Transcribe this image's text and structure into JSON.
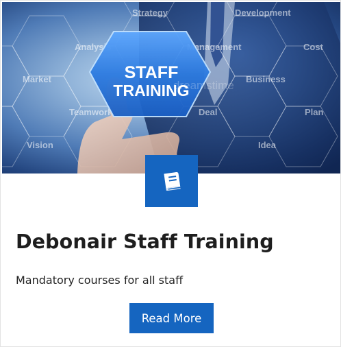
{
  "card": {
    "title": "Debonair Staff Training",
    "description": "Mandatory courses for all staff",
    "button_label": "Read More"
  },
  "hero": {
    "badge_line1": "STAFF",
    "badge_line2": "TRAINING",
    "watermark": "dreamstime",
    "hex_words": [
      "Analysis",
      "Management",
      "Market",
      "Business",
      "Teamwork",
      "Deal",
      "Vision",
      "Idea",
      "Development",
      "Plan",
      "Strategy",
      "Cost"
    ]
  },
  "icons": {
    "badge_icon": "book-icon"
  },
  "colors": {
    "accent": "#1565c0",
    "hero_hex": "#2f7fe0",
    "text": "#1e1e1e"
  }
}
